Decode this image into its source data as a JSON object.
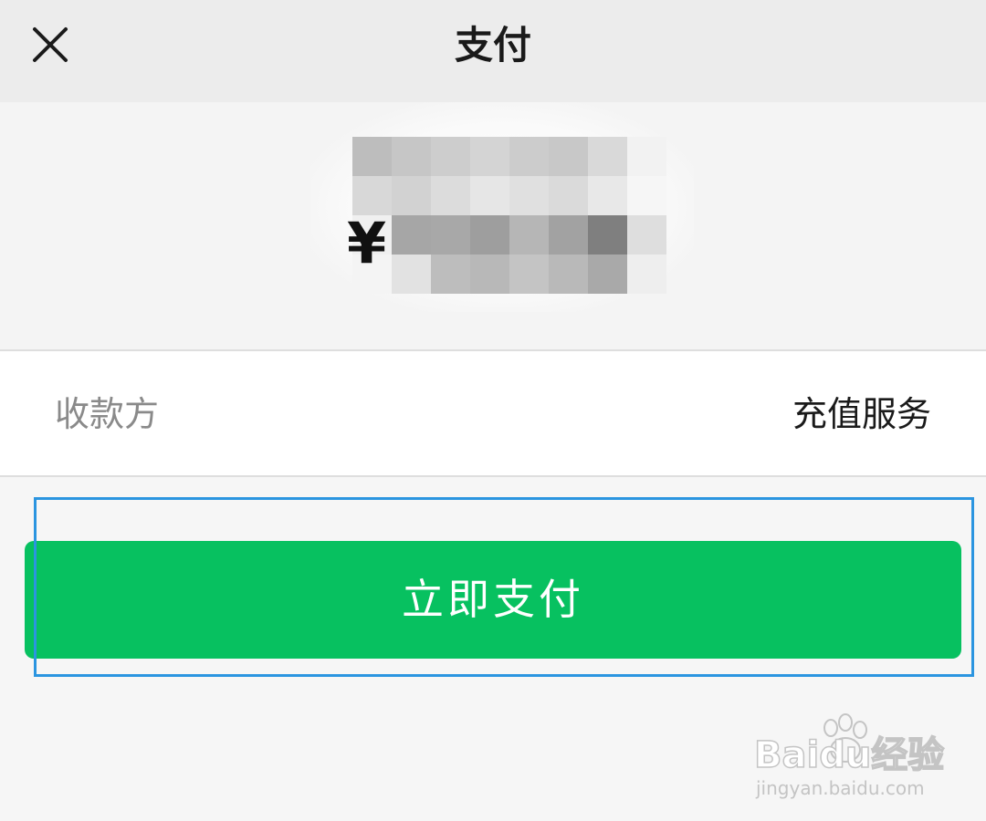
{
  "nav": {
    "title": "支付",
    "close_icon": "close-icon"
  },
  "amount": {
    "currency_symbol": "¥",
    "value_obscured": true
  },
  "payee": {
    "label": "收款方",
    "value": "充值服务"
  },
  "actions": {
    "pay_label": "立即支付",
    "pay_color": "#07c160"
  },
  "annotation": {
    "highlight_color": "#2b95e0"
  },
  "watermark": {
    "brand": "Baidu经验",
    "url": "jingyan.baidu.com"
  }
}
